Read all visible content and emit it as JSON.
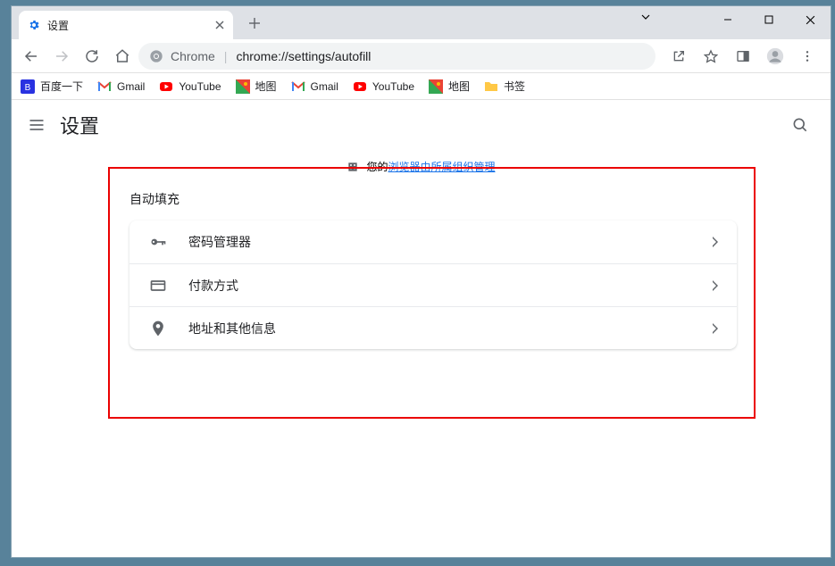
{
  "tab": {
    "title": "设置"
  },
  "addr": {
    "prefix": "Chrome",
    "url": "chrome://settings/autofill"
  },
  "bookmarks": [
    {
      "label": "百度一下",
      "icon": "baidu"
    },
    {
      "label": "Gmail",
      "icon": "gmail"
    },
    {
      "label": "YouTube",
      "icon": "youtube"
    },
    {
      "label": "地图",
      "icon": "maps"
    },
    {
      "label": "Gmail",
      "icon": "gmail"
    },
    {
      "label": "YouTube",
      "icon": "youtube"
    },
    {
      "label": "地图",
      "icon": "maps"
    },
    {
      "label": "书签",
      "icon": "folder"
    }
  ],
  "settings_header": "设置",
  "managed": {
    "prefix": "您的",
    "link": "浏览器由所属组织管理"
  },
  "section": {
    "title": "自动填充",
    "items": [
      {
        "label": "密码管理器",
        "icon": "key"
      },
      {
        "label": "付款方式",
        "icon": "card"
      },
      {
        "label": "地址和其他信息",
        "icon": "pin"
      }
    ]
  }
}
